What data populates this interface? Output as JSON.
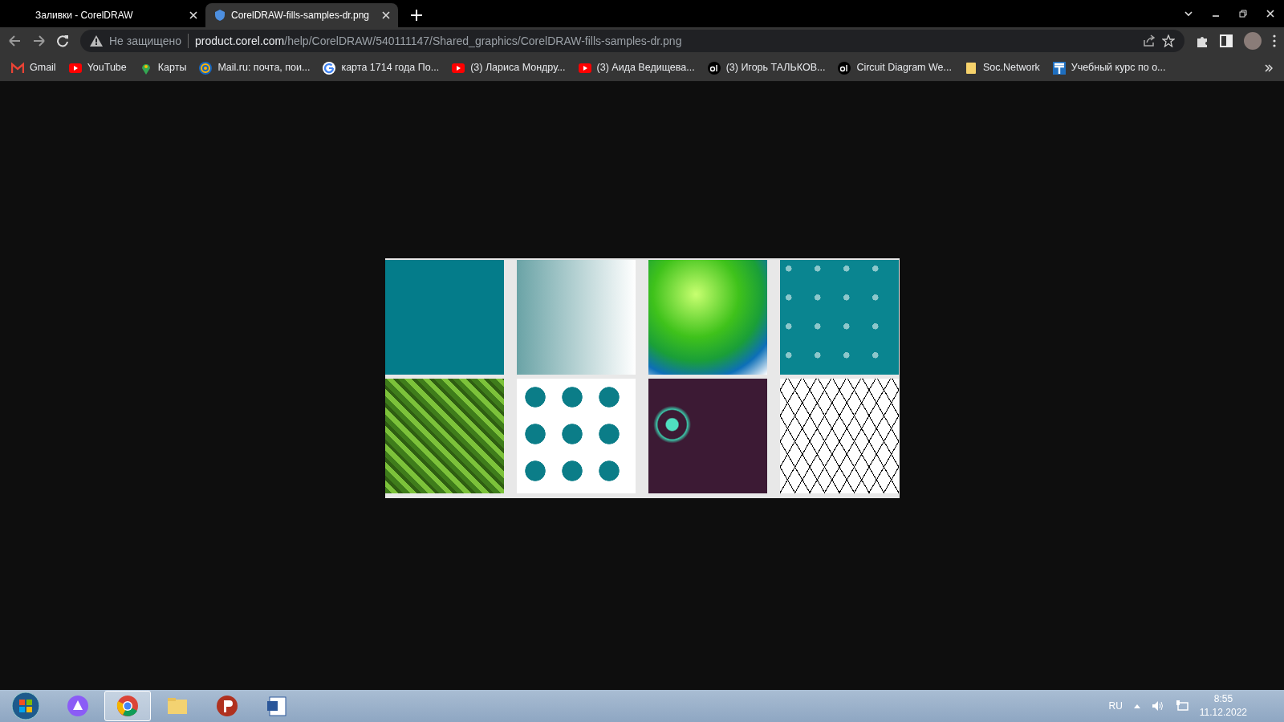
{
  "tabs": [
    {
      "title": "Заливки - CorelDRAW",
      "selected": false
    },
    {
      "title": "CorelDRAW-fills-samples-dr.png",
      "selected": true
    }
  ],
  "address_bar": {
    "security_label": "Не защищено",
    "url_host": "product.corel.com",
    "url_path": "/help/CorelDRAW/540111147/Shared_graphics/CorelDRAW-fills-samples-dr.png"
  },
  "bookmarks": [
    {
      "label": "Gmail",
      "kind": "mail-m"
    },
    {
      "label": "YouTube",
      "kind": "play"
    },
    {
      "label": "Карты",
      "kind": "pin"
    },
    {
      "label": "Mail.ru: почта, пои...",
      "kind": "at"
    },
    {
      "label": "карта 1714 года По...",
      "kind": "g"
    },
    {
      "label": "(3) Лариса Мондру...",
      "kind": "play"
    },
    {
      "label": "(3) Аида Ведищева...",
      "kind": "play"
    },
    {
      "label": "(3) Игорь ТАЛЬКОВ...",
      "kind": "cd"
    },
    {
      "label": "Circuit Diagram We...",
      "kind": "cd"
    },
    {
      "label": "Soc.Network",
      "kind": "folder"
    },
    {
      "label": "Учебный курс по о...",
      "kind": "t"
    }
  ],
  "taskbar": {
    "apps": [
      {
        "kind": "alice",
        "selected": false
      },
      {
        "kind": "browser",
        "selected": true
      },
      {
        "kind": "folder",
        "selected": false
      },
      {
        "kind": "p",
        "selected": false
      },
      {
        "kind": "doc",
        "selected": false
      }
    ],
    "language": "RU",
    "time": "8:55",
    "date": "11.12.2022"
  }
}
